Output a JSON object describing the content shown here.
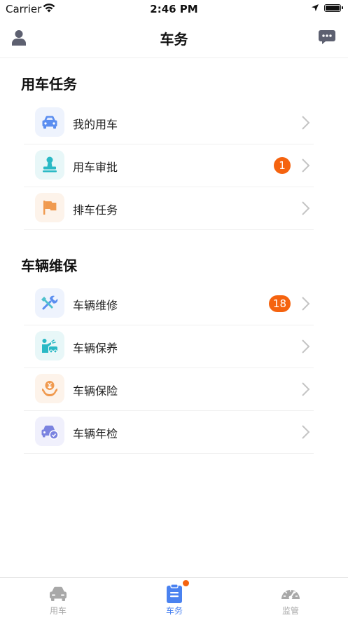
{
  "status_bar": {
    "carrier": "Carrier",
    "time": "2:46 PM"
  },
  "nav": {
    "title": "车务"
  },
  "sections": [
    {
      "title": "用车任务",
      "items": [
        {
          "label": "我的用车",
          "icon": "car-icon",
          "badge": ""
        },
        {
          "label": "用车审批",
          "icon": "stamp-icon",
          "badge": "1"
        },
        {
          "label": "排车任务",
          "icon": "flag-icon",
          "badge": ""
        }
      ]
    },
    {
      "title": "车辆维保",
      "items": [
        {
          "label": "车辆维修",
          "icon": "tools-icon",
          "badge": "18"
        },
        {
          "label": "车辆保养",
          "icon": "car-wash-icon",
          "badge": ""
        },
        {
          "label": "车辆保险",
          "icon": "insurance-icon",
          "badge": ""
        },
        {
          "label": "车辆年检",
          "icon": "inspection-icon",
          "badge": ""
        }
      ]
    }
  ],
  "tabs": [
    {
      "label": "用车",
      "icon": "car-tab-icon",
      "active": false
    },
    {
      "label": "车务",
      "icon": "clipboard-tab-icon",
      "active": true,
      "dot": true
    },
    {
      "label": "监管",
      "icon": "gauge-tab-icon",
      "active": false
    }
  ],
  "colors": {
    "accent": "#4a82f0",
    "badge": "#f5630f",
    "tab_inactive": "#a8a8a8",
    "chevron": "#c4c4c4"
  }
}
